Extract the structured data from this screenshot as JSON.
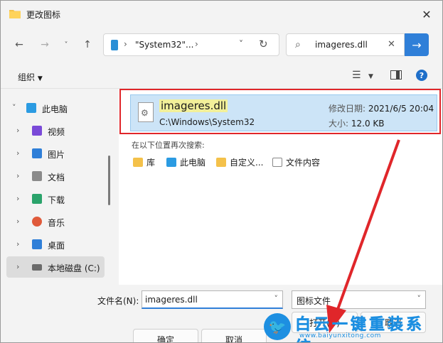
{
  "window": {
    "title": "更改图标"
  },
  "nav": {
    "path_text": "\"System32\"...",
    "search_value": "imageres.dll",
    "go_icon": "arrow-right-icon"
  },
  "toolbar": {
    "organize_label": "组织",
    "help_symbol": "?"
  },
  "sidebar": {
    "items": [
      {
        "label": "此电脑",
        "icon": "pc-icon",
        "color": "#2b9be2"
      },
      {
        "label": "视频",
        "icon": "video-icon",
        "color": "#7a4ad8"
      },
      {
        "label": "图片",
        "icon": "pictures-icon",
        "color": "#2f7fd8"
      },
      {
        "label": "文档",
        "icon": "documents-icon",
        "color": "#8a8a8a"
      },
      {
        "label": "下载",
        "icon": "downloads-icon",
        "color": "#2aa36b"
      },
      {
        "label": "音乐",
        "icon": "music-icon",
        "color": "#e05a3a"
      },
      {
        "label": "桌面",
        "icon": "desktop-icon",
        "color": "#2f7fd8"
      },
      {
        "label": "本地磁盘 (C:)",
        "icon": "drive-icon",
        "color": "#6b6b6b"
      }
    ]
  },
  "result": {
    "name": "imageres.dll",
    "path": "C:\\Windows\\System32",
    "modified_label": "修改日期:",
    "modified_value": "2021/6/5 20:04",
    "size_label": "大小:",
    "size_value": "12.0 KB"
  },
  "search_again": {
    "title": "在以下位置再次搜索:",
    "locations": [
      "库",
      "此电脑",
      "自定义...",
      "文件内容"
    ]
  },
  "bottom": {
    "filename_label": "文件名(N):",
    "filename_value": "imageres.dll",
    "filetype_value": "图标文件",
    "open_label": "打开(O)",
    "cancel_label": "取消",
    "ok_label": "确定",
    "cancel2_label": "取消"
  },
  "watermark": {
    "big_text": "白云一键重装系统",
    "small_text": "www.baiyunxitong.com"
  }
}
